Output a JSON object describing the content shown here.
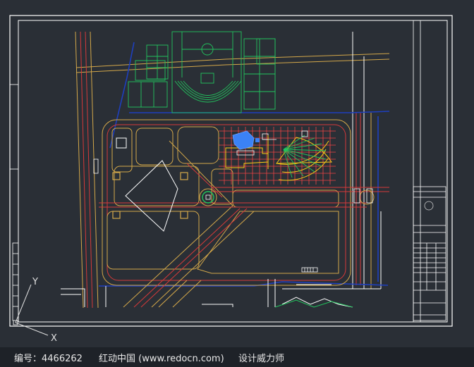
{
  "colors": {
    "background": "#2a2f36",
    "frame": "#ffffff",
    "road_outer": "#d4a84a",
    "road_inner": "#d63a3a",
    "curb": "#ffffff",
    "field": "#22c55e",
    "building": "#3b82f6",
    "grid": "#ef4444",
    "accent_yellow": "#facc15",
    "blue_line": "#1e3fbf"
  },
  "axes": {
    "y_label": "Y",
    "x_label": "X"
  },
  "footer": {
    "id_label": "编号：4466262",
    "site": "红动中国 (www.redocn.com)",
    "author": "设计威力师"
  }
}
